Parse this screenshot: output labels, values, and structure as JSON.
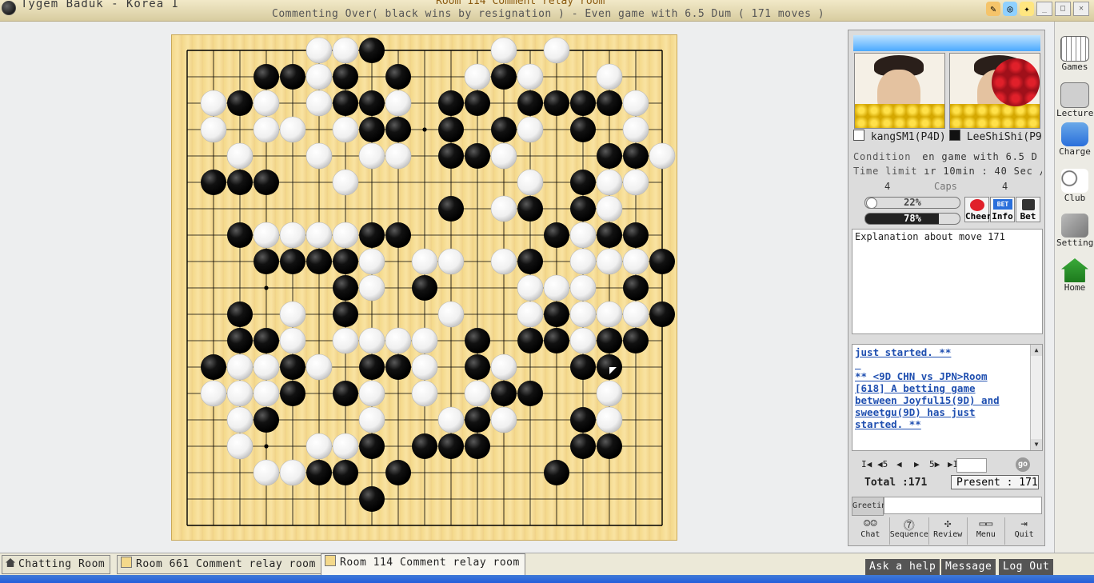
{
  "window": {
    "app_title": "Tygem Baduk - Korea I",
    "room_title": "Room 114 Comment relay room",
    "status_line": "Commenting Over( black wins by resignation ) - Even game with 6.5 Dum  ( 171 moves )"
  },
  "board": {
    "size": 19,
    "white_stones": [
      [
        5,
        0
      ],
      [
        6,
        0
      ],
      [
        12,
        0
      ],
      [
        14,
        0
      ],
      [
        5,
        1
      ],
      [
        11,
        1
      ],
      [
        13,
        1
      ],
      [
        16,
        1
      ],
      [
        1,
        2
      ],
      [
        3,
        2
      ],
      [
        5,
        2
      ],
      [
        8,
        2
      ],
      [
        17,
        2
      ],
      [
        1,
        3
      ],
      [
        3,
        3
      ],
      [
        4,
        3
      ],
      [
        6,
        3
      ],
      [
        13,
        3
      ],
      [
        17,
        3
      ],
      [
        2,
        4
      ],
      [
        5,
        4
      ],
      [
        7,
        4
      ],
      [
        8,
        4
      ],
      [
        12,
        4
      ],
      [
        18,
        4
      ],
      [
        6,
        5
      ],
      [
        13,
        5
      ],
      [
        16,
        5
      ],
      [
        17,
        5
      ],
      [
        12,
        6
      ],
      [
        16,
        6
      ],
      [
        3,
        7
      ],
      [
        4,
        7
      ],
      [
        5,
        7
      ],
      [
        6,
        7
      ],
      [
        15,
        7
      ],
      [
        7,
        8
      ],
      [
        9,
        8
      ],
      [
        10,
        8
      ],
      [
        12,
        8
      ],
      [
        15,
        8
      ],
      [
        16,
        8
      ],
      [
        17,
        8
      ],
      [
        7,
        9
      ],
      [
        13,
        9
      ],
      [
        14,
        9
      ],
      [
        15,
        9
      ],
      [
        4,
        10
      ],
      [
        10,
        10
      ],
      [
        13,
        10
      ],
      [
        15,
        10
      ],
      [
        16,
        10
      ],
      [
        17,
        10
      ],
      [
        4,
        11
      ],
      [
        6,
        11
      ],
      [
        7,
        11
      ],
      [
        8,
        11
      ],
      [
        9,
        11
      ],
      [
        15,
        11
      ],
      [
        2,
        12
      ],
      [
        3,
        12
      ],
      [
        5,
        12
      ],
      [
        9,
        12
      ],
      [
        12,
        12
      ],
      [
        1,
        13
      ],
      [
        2,
        13
      ],
      [
        3,
        13
      ],
      [
        7,
        13
      ],
      [
        9,
        13
      ],
      [
        11,
        13
      ],
      [
        16,
        13
      ],
      [
        2,
        14
      ],
      [
        7,
        14
      ],
      [
        10,
        14
      ],
      [
        12,
        14
      ],
      [
        16,
        14
      ],
      [
        2,
        15
      ],
      [
        5,
        15
      ],
      [
        6,
        15
      ],
      [
        3,
        16
      ],
      [
        4,
        16
      ]
    ],
    "black_stones": [
      [
        7,
        0
      ],
      [
        3,
        1
      ],
      [
        4,
        1
      ],
      [
        6,
        1
      ],
      [
        8,
        1
      ],
      [
        12,
        1
      ],
      [
        2,
        2
      ],
      [
        6,
        2
      ],
      [
        7,
        2
      ],
      [
        10,
        2
      ],
      [
        11,
        2
      ],
      [
        13,
        2
      ],
      [
        14,
        2
      ],
      [
        15,
        2
      ],
      [
        16,
        2
      ],
      [
        7,
        3
      ],
      [
        8,
        3
      ],
      [
        10,
        3
      ],
      [
        12,
        3
      ],
      [
        15,
        3
      ],
      [
        10,
        4
      ],
      [
        11,
        4
      ],
      [
        16,
        4
      ],
      [
        17,
        4
      ],
      [
        1,
        5
      ],
      [
        2,
        5
      ],
      [
        3,
        5
      ],
      [
        15,
        5
      ],
      [
        10,
        6
      ],
      [
        13,
        6
      ],
      [
        15,
        6
      ],
      [
        2,
        7
      ],
      [
        7,
        7
      ],
      [
        8,
        7
      ],
      [
        14,
        7
      ],
      [
        16,
        7
      ],
      [
        17,
        7
      ],
      [
        3,
        8
      ],
      [
        4,
        8
      ],
      [
        5,
        8
      ],
      [
        6,
        8
      ],
      [
        13,
        8
      ],
      [
        18,
        8
      ],
      [
        6,
        9
      ],
      [
        9,
        9
      ],
      [
        17,
        9
      ],
      [
        2,
        10
      ],
      [
        6,
        10
      ],
      [
        14,
        10
      ],
      [
        18,
        10
      ],
      [
        2,
        11
      ],
      [
        3,
        11
      ],
      [
        11,
        11
      ],
      [
        13,
        11
      ],
      [
        14,
        11
      ],
      [
        16,
        11
      ],
      [
        17,
        11
      ],
      [
        1,
        12
      ],
      [
        4,
        12
      ],
      [
        7,
        12
      ],
      [
        8,
        12
      ],
      [
        11,
        12
      ],
      [
        15,
        12
      ],
      [
        16,
        12
      ],
      [
        4,
        13
      ],
      [
        6,
        13
      ],
      [
        12,
        13
      ],
      [
        13,
        13
      ],
      [
        3,
        14
      ],
      [
        11,
        14
      ],
      [
        15,
        14
      ],
      [
        7,
        15
      ],
      [
        9,
        15
      ],
      [
        10,
        15
      ],
      [
        11,
        15
      ],
      [
        15,
        15
      ],
      [
        16,
        15
      ],
      [
        5,
        16
      ],
      [
        6,
        16
      ],
      [
        8,
        16
      ],
      [
        14,
        16
      ],
      [
        7,
        17
      ]
    ],
    "last_move": [
      16,
      12
    ]
  },
  "players": {
    "white": {
      "name": "kangSM1(P4D)"
    },
    "black": {
      "name": "LeeShiShi(P9"
    }
  },
  "game_info": {
    "condition_label": "Condition",
    "condition_value": "en game with 6.5 D",
    "time_label": "Time limit",
    "time_value": "ır 10min : 40 Sec /",
    "caps_label": "Caps",
    "caps_white": "4",
    "caps_black": "4",
    "win_white_text": "22%",
    "win_white_fraction": 0.22,
    "win_black_text": "78%",
    "win_black_fraction": 0.78
  },
  "actions": {
    "cheer": "Cheer",
    "bet_info_badge": "BET",
    "info": "Info",
    "bet": "Bet"
  },
  "explanation": "Explanation about move 171",
  "chat_log": [
    "just started. **",
    "",
    "** <9D CHN vs JPN>Room",
    "[618] A betting game",
    "between Joyful15(9D) and",
    "sweetgu(9D) has just",
    "started. **"
  ],
  "navigation": {
    "first": "I◀",
    "back5": "◀5",
    "prev": "◀",
    "next": "▶",
    "fwd5": "5▶",
    "last": "▶I",
    "go": "go",
    "total_text": "Total :171",
    "present_text": "Present : 171"
  },
  "greeting_label": "Greeting",
  "bottom_buttons": [
    "Chat",
    "Sequence",
    "Review",
    "Menu",
    "Quit"
  ],
  "sidebar": [
    "Games",
    "Lecture",
    "Charge",
    "Club",
    "Setting",
    "Home"
  ],
  "tabs": [
    "Chatting Room",
    "Room 661 Comment relay room",
    "Room 114 Comment relay room"
  ],
  "bottom_right": [
    "Ask a help",
    "Message",
    "Log Out"
  ]
}
